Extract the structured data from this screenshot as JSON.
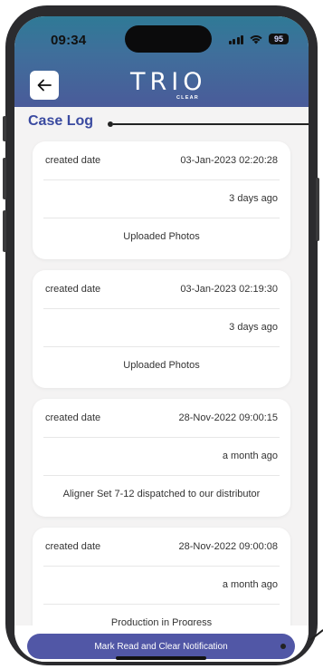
{
  "status_bar": {
    "time": "09:34",
    "battery": "95",
    "icons": [
      "signal-icon",
      "wifi-icon",
      "battery-icon"
    ]
  },
  "header": {
    "back_icon": "arrow-left-icon",
    "logo_text": "TRIO",
    "logo_subtext": "CLEAR",
    "gradient_colors": [
      "#2f7a96",
      "#4a5b9a"
    ]
  },
  "page": {
    "title": "Case Log",
    "title_color": "#3a4aa0"
  },
  "log_entries": [
    {
      "label": "created date",
      "date": "03-Jan-2023 02:20:28",
      "relative": "3 days ago",
      "description": "Uploaded Photos"
    },
    {
      "label": "created date",
      "date": "03-Jan-2023 02:19:30",
      "relative": "3 days ago",
      "description": "Uploaded Photos"
    },
    {
      "label": "created date",
      "date": "28-Nov-2022 09:00:15",
      "relative": "a month ago",
      "description": "Aligner Set 7-12 dispatched to our distributor"
    },
    {
      "label": "created date",
      "date": "28-Nov-2022 09:00:08",
      "relative": "a month ago",
      "description": "Production in Progress"
    }
  ],
  "footer": {
    "button_label": "Mark Read and Clear Notification",
    "button_color": "#5157a6"
  }
}
